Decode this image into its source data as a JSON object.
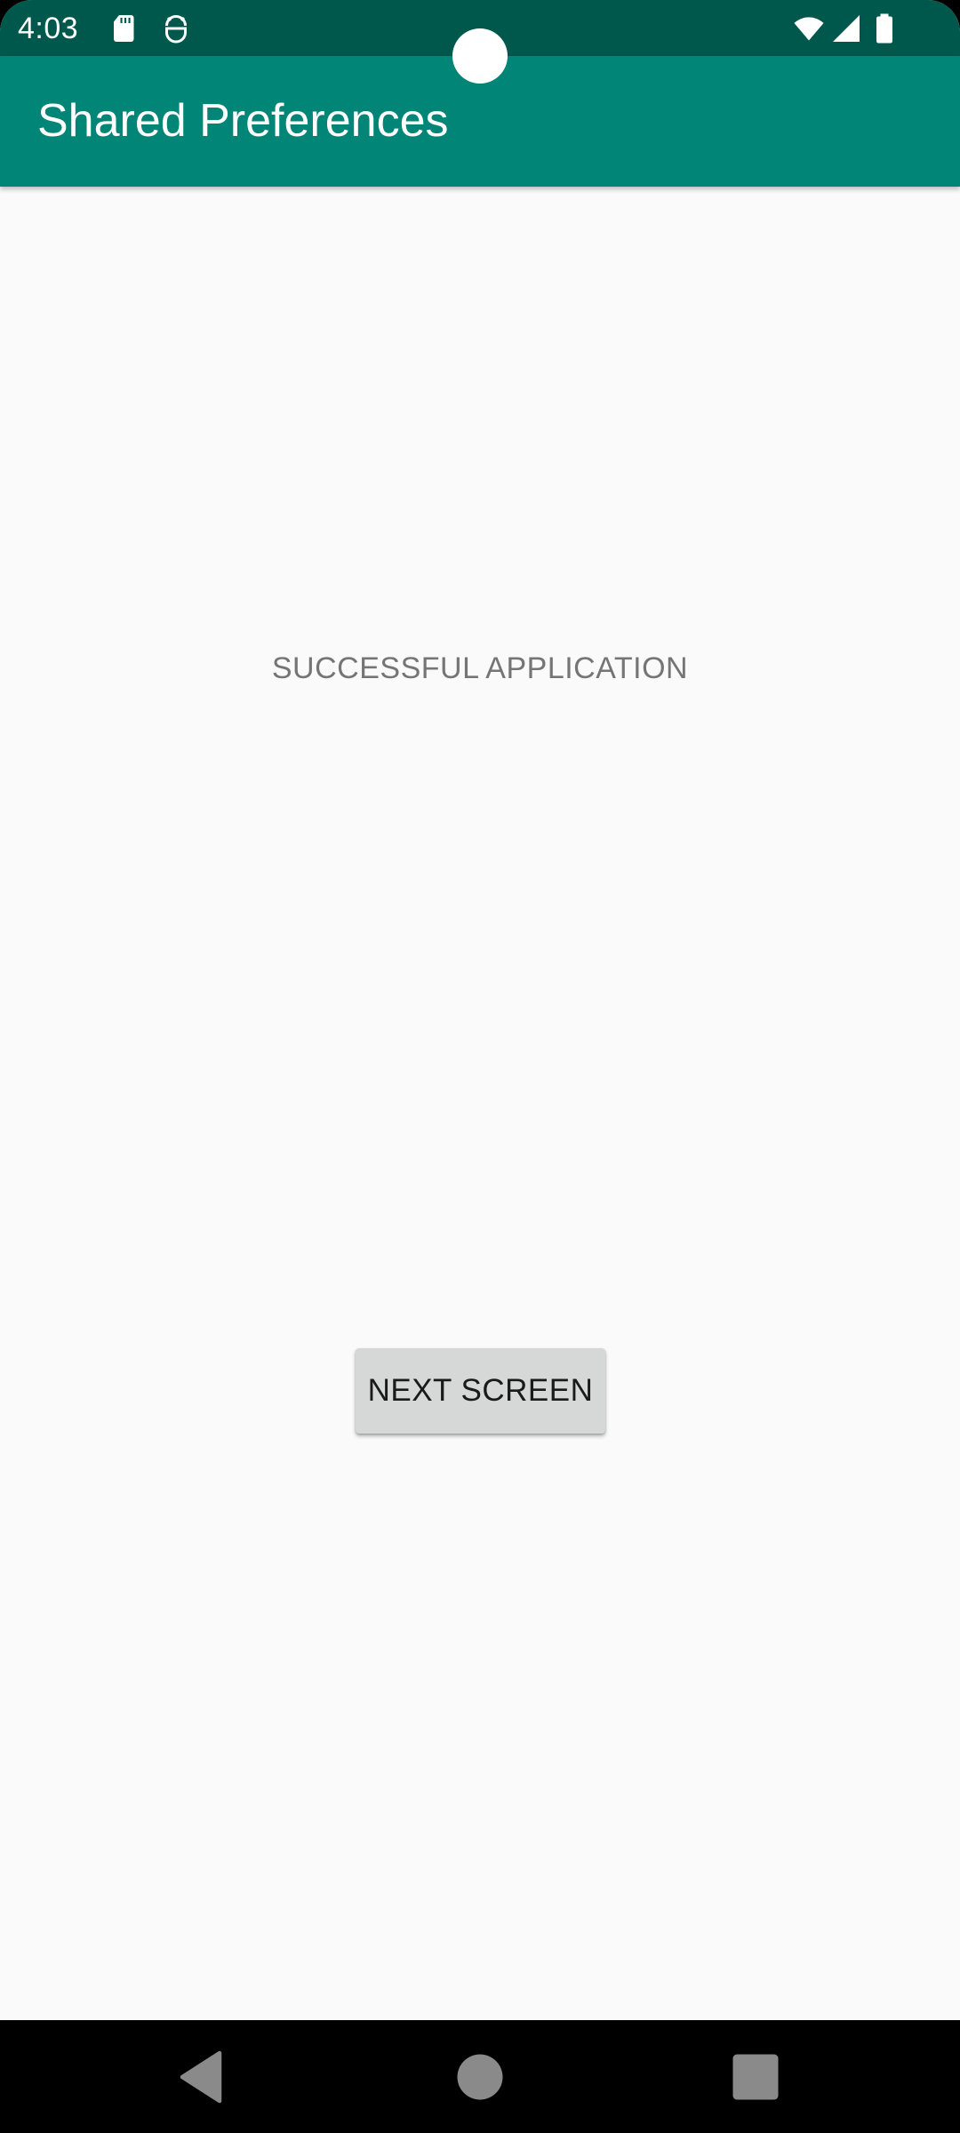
{
  "status_bar": {
    "time": "4:03",
    "icons": [
      "sd-card-icon",
      "android-debug-icon",
      "wifi-icon",
      "cell-signal-icon",
      "battery-icon"
    ]
  },
  "app_bar": {
    "title": "Shared Preferences"
  },
  "main": {
    "message": "SUCCESSFUL APPLICATION",
    "next_button_label": "NEXT SCREEN"
  },
  "nav_bar": {
    "buttons": [
      "back-icon",
      "home-icon",
      "recents-icon"
    ]
  },
  "colors": {
    "status_bar": "#00574b",
    "app_bar": "#008577",
    "background": "#fafafa",
    "button": "#d6d7d7"
  }
}
